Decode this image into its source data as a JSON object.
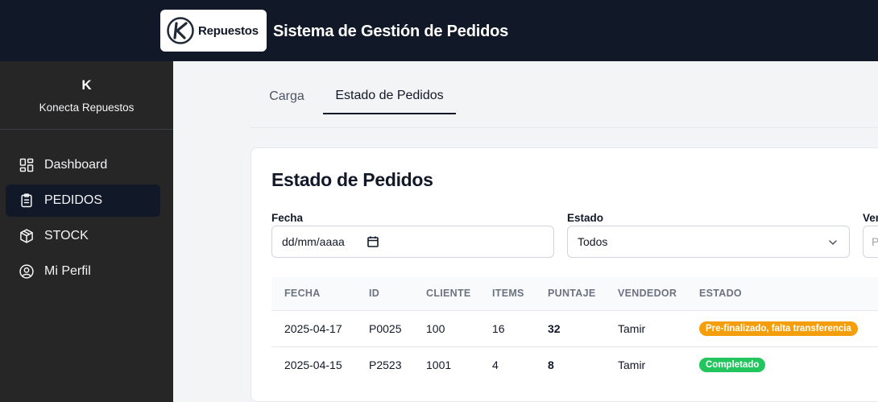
{
  "header": {
    "logo_text": "Repuestos",
    "logo_icon": "k-circle-logo",
    "title": "Sistema de Gestión de Pedidos"
  },
  "sidebar": {
    "brand_initial": "K",
    "brand_name": "Konecta Repuestos",
    "items": [
      {
        "label": "Dashboard",
        "icon": "dashboard-icon",
        "active": false
      },
      {
        "label": "PEDIDOS",
        "icon": "clipboard-icon",
        "active": true
      },
      {
        "label": "STOCK",
        "icon": "box-icon",
        "active": false
      },
      {
        "label": "Mi Perfil",
        "icon": "user-circle-icon",
        "active": false
      }
    ]
  },
  "tabs": [
    {
      "label": "Carga",
      "active": false
    },
    {
      "label": "Estado de Pedidos",
      "active": true
    }
  ],
  "card": {
    "title": "Estado de Pedidos",
    "filters": {
      "fecha_label": "Fecha",
      "fecha_placeholder": "dd/mm/aaaa",
      "estado_label": "Estado",
      "estado_value": "Todos",
      "vendedor_label": "Ven",
      "vendedor_placeholder": "P"
    },
    "table": {
      "headers": [
        "FECHA",
        "ID",
        "CLIENTE",
        "ITEMS",
        "PUNTAJE",
        "VENDEDOR",
        "ESTADO"
      ],
      "rows": [
        {
          "fecha": "2025-04-17",
          "id": "P0025",
          "cliente": "100",
          "items": "16",
          "puntaje": "32",
          "vendedor": "Tamir",
          "estado": "Pre-finalizado, falta transferencia",
          "estado_color": "#f59e0b"
        },
        {
          "fecha": "2025-04-15",
          "id": "P2523",
          "cliente": "1001",
          "items": "4",
          "puntaje": "8",
          "vendedor": "Tamir",
          "estado": "Completado",
          "estado_color": "#22c55e"
        }
      ]
    }
  },
  "colors": {
    "header_bg": "#111827",
    "sidebar_bg": "#262626",
    "sidebar_active_bg": "#111827",
    "content_bg": "#f3f4f6",
    "pending_badge": "#f59e0b",
    "completed_badge": "#22c55e"
  }
}
